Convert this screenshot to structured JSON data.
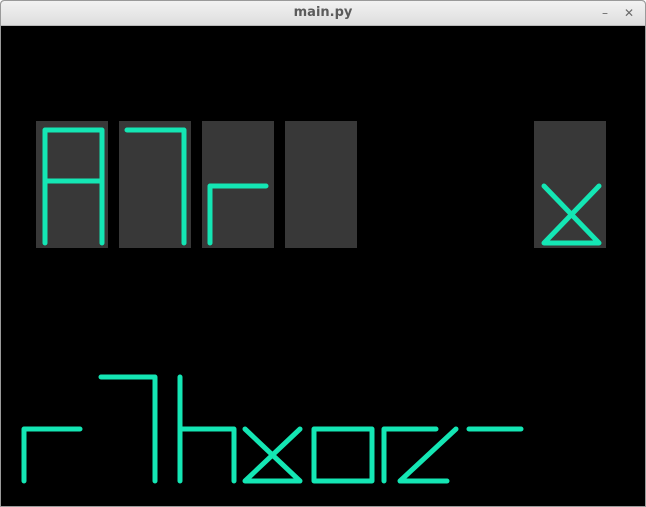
{
  "window": {
    "title": "main.py"
  },
  "controls": {
    "minimize_glyph": "–",
    "close_glyph": "✕"
  },
  "colors": {
    "glyph": "#14e6b4",
    "tile": "#383838",
    "background": "#000000",
    "titlebar_text": "#5b5b5b"
  },
  "top_row_slots": [
    {
      "filled": true
    },
    {
      "filled": true
    },
    {
      "filled": true
    },
    {
      "filled": false
    },
    {
      "filled": true
    }
  ],
  "bottom_row_glyph_count": 9
}
